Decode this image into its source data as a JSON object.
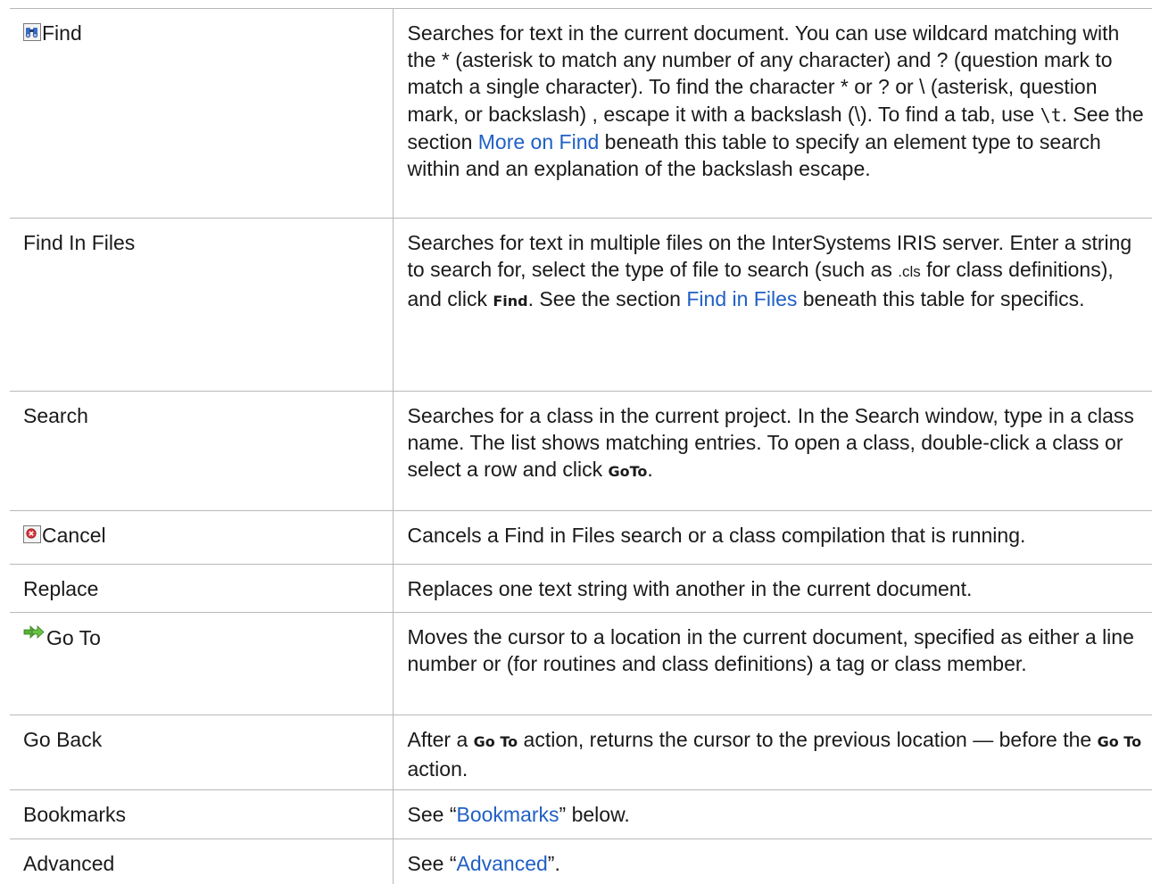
{
  "rows": [
    {
      "command": "Find",
      "icon": "binoculars-icon",
      "desc": {
        "t1": "Searches for text in the current document. You can use wildcard matching with the * (asterisk to match any number of any character) and ? (question mark to match a single character). To find the character * or ? or \\ (asterisk, question mark, or backslash) , escape it with a backslash (\\). To find a tab, use ",
        "code": "\\t",
        "t2": ". See the section ",
        "link": "More on Find",
        "t3": " beneath this table to specify an element type to search within and an explanation of the backslash escape."
      }
    },
    {
      "command": "Find In Files",
      "desc": {
        "t1": "Searches for text in multiple files on the InterSystems IRIS server. Enter a string to search for, select the type of file to search (such as ",
        "small": ".cls",
        "t2": " for class definitions), and click ",
        "bold": "Find",
        "t3": ". See the section ",
        "link": "Find in Files",
        "t4": " beneath this table for specifics."
      }
    },
    {
      "command": "Search",
      "desc": {
        "t1": "Searches for a class in the current project. In the Search window, type in a class name. The list shows matching entries. To open a class, double-click a class or select a row and click ",
        "bold": "GoTo",
        "t2": "."
      }
    },
    {
      "command": "Cancel",
      "icon": "cancel-icon",
      "desc": {
        "t1": "Cancels a Find in Files search or a class compilation that is running."
      }
    },
    {
      "command": "Replace",
      "desc": {
        "t1": "Replaces one text string with another in the current document."
      }
    },
    {
      "command": "Go To",
      "icon": "go-to-arrow-icon",
      "desc": {
        "t1": "Moves the cursor to a location in the current document, specified as either a line number or (for routines and class definitions) a tag or class member."
      }
    },
    {
      "command": "Go Back",
      "desc": {
        "t1": "After a ",
        "bold1": "Go To",
        "t2": " action, returns the cursor to the previous location — before the ",
        "bold2": "Go To",
        "t3": " action."
      }
    },
    {
      "command": "Bookmarks",
      "desc": {
        "t1": "See “",
        "link": "Bookmarks",
        "t2": "” below."
      }
    },
    {
      "command": "Advanced",
      "desc": {
        "t1": "See “",
        "link": "Advanced",
        "t2": "”."
      }
    }
  ]
}
